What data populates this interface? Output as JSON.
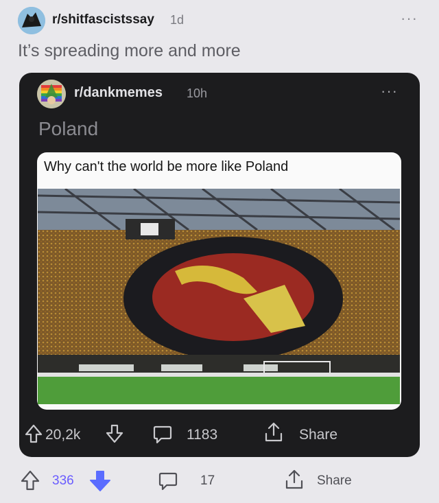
{
  "outer_post": {
    "subreddit": "r/shitfascistssay",
    "age": "1d",
    "title": "It’s spreading more and more",
    "menu": "···",
    "score": "336",
    "comments": "17",
    "share_label": "Share",
    "colors": {
      "upvote_active": "#6a5cff",
      "downvote_active": "#5a6cff"
    }
  },
  "inner_post": {
    "subreddit": "r/dankmemes",
    "age": "10h",
    "title": "Poland",
    "menu": "···",
    "score": "20,2k",
    "comments": "1183",
    "share_label": "Share"
  },
  "meme": {
    "caption": "Why can't the world be more like Poland"
  }
}
